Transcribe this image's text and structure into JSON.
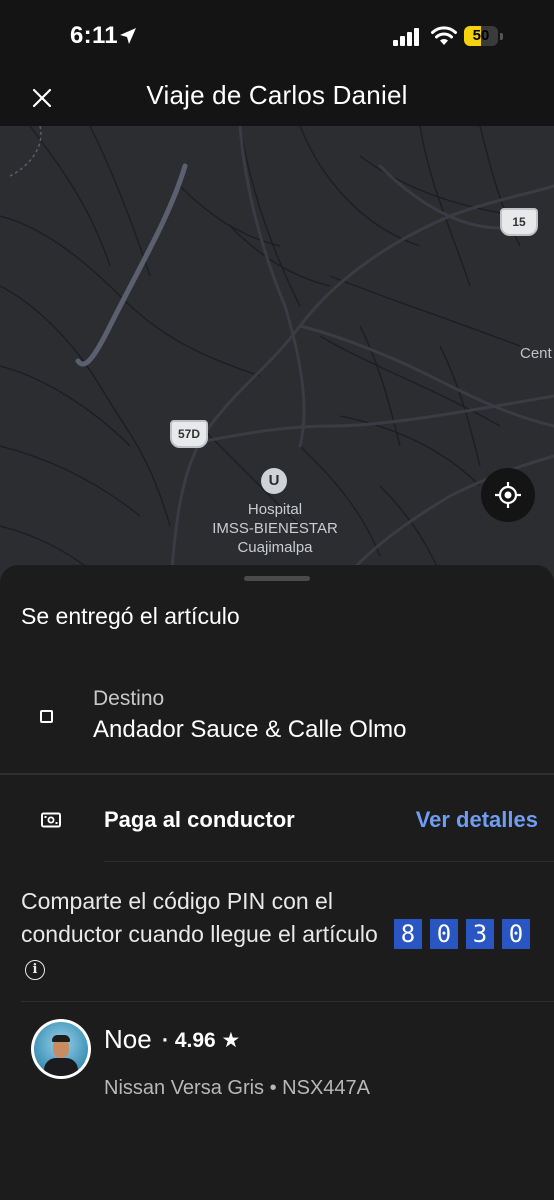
{
  "status_bar": {
    "time": "6:11",
    "battery": "50",
    "battery_level": 0.5
  },
  "header": {
    "title": "Viaje de Carlos Daniel"
  },
  "map": {
    "shields": [
      "15",
      "57D"
    ],
    "poi_label": "Hospital\nIMSS-BIENESTAR\nCuajimalpa",
    "edge_label": "Cent"
  },
  "sheet": {
    "status": "Se entregó el artículo",
    "destination": {
      "label": "Destino",
      "value": "Andador Sauce & Calle Olmo"
    },
    "payment": {
      "label": "Paga al conductor",
      "link": "Ver detalles"
    },
    "pin": {
      "text": "Comparte el código PIN con el conductor cuando llegue el artículo",
      "digits": [
        "8",
        "0",
        "3",
        "0"
      ]
    },
    "driver": {
      "name": "Noe",
      "rating": "· 4.96 ★",
      "vehicle": "Nissan Versa Gris • NSX447A"
    }
  },
  "colors": {
    "background": "#141414",
    "sheet": "#1c1c1c",
    "link": "#6f9df0",
    "pin_box": "#2a56c4",
    "battery": "#f5d20b"
  }
}
